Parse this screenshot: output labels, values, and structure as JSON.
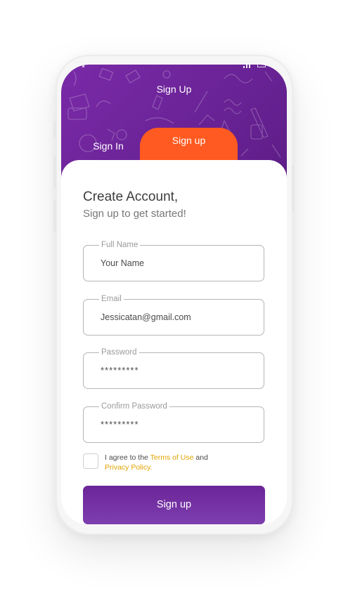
{
  "header": {
    "title": "Sign Up"
  },
  "tabs": {
    "sign_in_label": "Sign In",
    "sign_up_label": "Sign up"
  },
  "card": {
    "title": "Create Account,",
    "subtitle": "Sign up to get started!"
  },
  "fields": {
    "full_name": {
      "label": "Full Name",
      "value": "Your Name"
    },
    "email": {
      "label": "Email",
      "value": "Jessicatan@gmail.com"
    },
    "password": {
      "label": "Password",
      "value": "*********"
    },
    "confirm_password": {
      "label": "Confirm Password",
      "value": "*********"
    }
  },
  "agreement": {
    "prefix": "I agree to the ",
    "terms_link": "Terms of Use",
    "middle": " and",
    "privacy_link": "Privacy Policy",
    "suffix": ".",
    "checked": false
  },
  "submit_label": "Sign up",
  "colors": {
    "header_purple": "#6a2396",
    "accent_orange": "#ff5a21",
    "button_purple": "#7330a2",
    "link_yellow": "#e0a400"
  }
}
